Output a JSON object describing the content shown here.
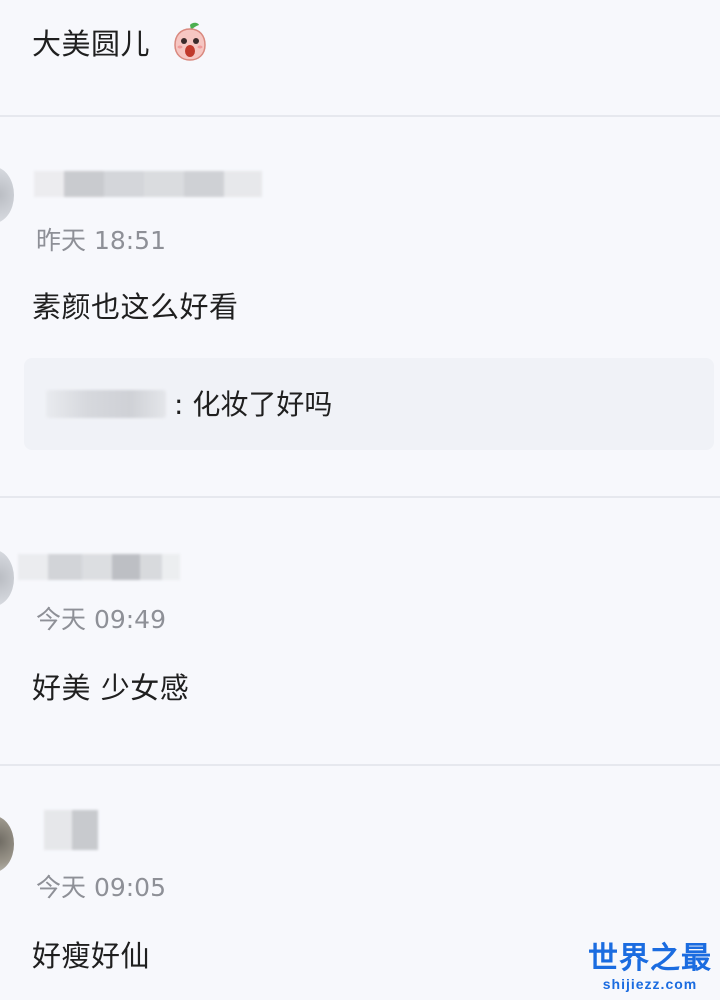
{
  "top_post": {
    "text": "大美圆儿",
    "emoji": "screaming-peach-emoji"
  },
  "comments": [
    {
      "time": "昨天 18:51",
      "text": "素颜也这么好看",
      "reply": {
        "text": ": 化妆了好吗"
      }
    },
    {
      "time": "今天 09:49",
      "text": "好美 少女感"
    },
    {
      "time": "今天 09:05",
      "text": "好瘦好仙"
    }
  ],
  "watermark": {
    "title": "世界之最",
    "url": "shijiezz.com"
  },
  "colors": {
    "background": "#f7f8fc",
    "divider": "#e6e8ee",
    "time": "#8e9097",
    "watermark": "#1b6ce0"
  }
}
